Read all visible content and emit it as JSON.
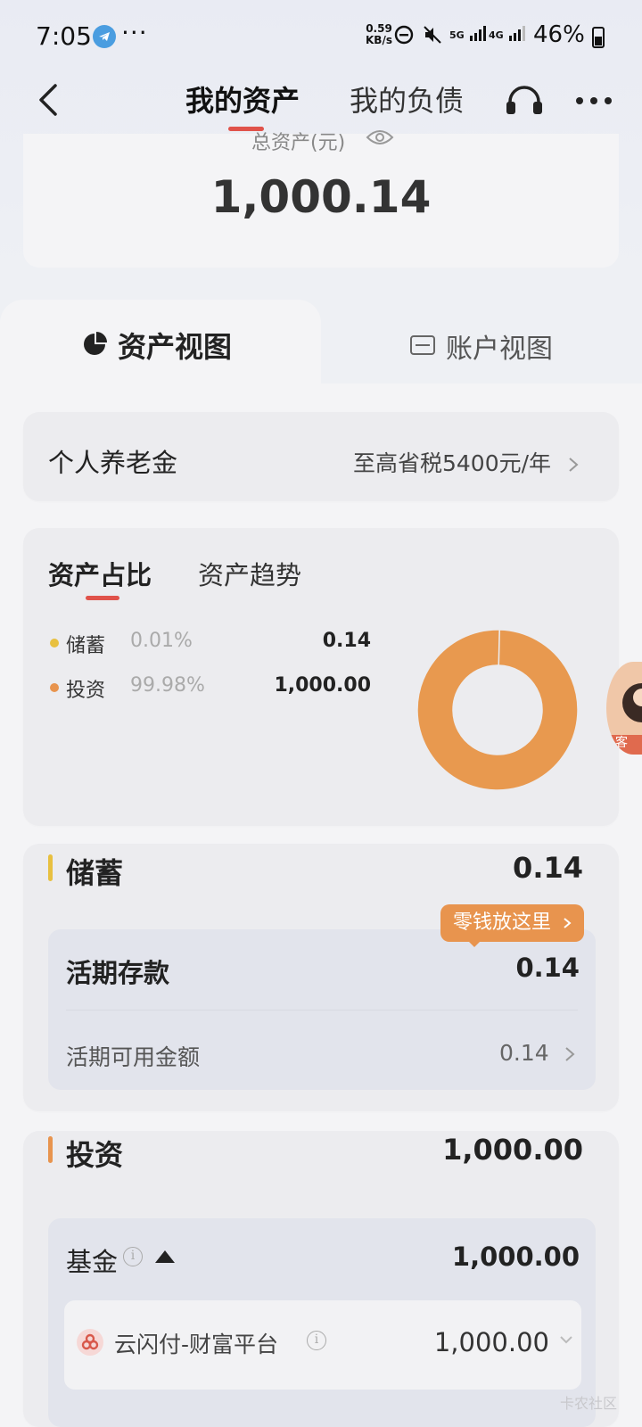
{
  "status_bar": {
    "time": "7:05",
    "net_speed_value": "0.59",
    "net_speed_unit": "KB/s",
    "sig1": "5G",
    "sig2": "4G",
    "battery": "46%"
  },
  "nav": {
    "tab_assets": "我的资产",
    "tab_liabilities": "我的负债"
  },
  "total": {
    "label": "总资产(元)",
    "value": "1,000.14"
  },
  "view_tabs": {
    "asset_view": "资产视图",
    "account_view": "账户视图"
  },
  "pension": {
    "title": "个人养老金",
    "promo": "至高省税5400元/年"
  },
  "breakdown": {
    "tab_share": "资产占比",
    "tab_trend": "资产趋势",
    "legend": [
      {
        "name": "储蓄",
        "pct": "0.01%",
        "value": "0.14",
        "color": "#e8c040"
      },
      {
        "name": "投资",
        "pct": "99.98%",
        "value": "1,000.00",
        "color": "#e8944e"
      }
    ]
  },
  "chart_data": {
    "type": "pie",
    "categories": [
      "储蓄",
      "投资"
    ],
    "values": [
      0.01,
      99.98
    ],
    "colors": [
      "#ecc84a",
      "#e8994f"
    ]
  },
  "savings": {
    "title": "储蓄",
    "value": "0.14",
    "bar_color": "#e8c040",
    "bubble": "零钱放这里",
    "demand_title": "活期存款",
    "demand_value": "0.14",
    "available_label": "活期可用金额",
    "available_value": "0.14"
  },
  "investment": {
    "title": "投资",
    "value": "1,000.00",
    "bar_color": "#e8944e",
    "fund_title": "基金",
    "fund_value": "1,000.00",
    "platform_name": "云闪付-财富平台",
    "platform_value": "1,000.00"
  },
  "floating": {
    "label": "客"
  },
  "watermark": "卡农社区"
}
